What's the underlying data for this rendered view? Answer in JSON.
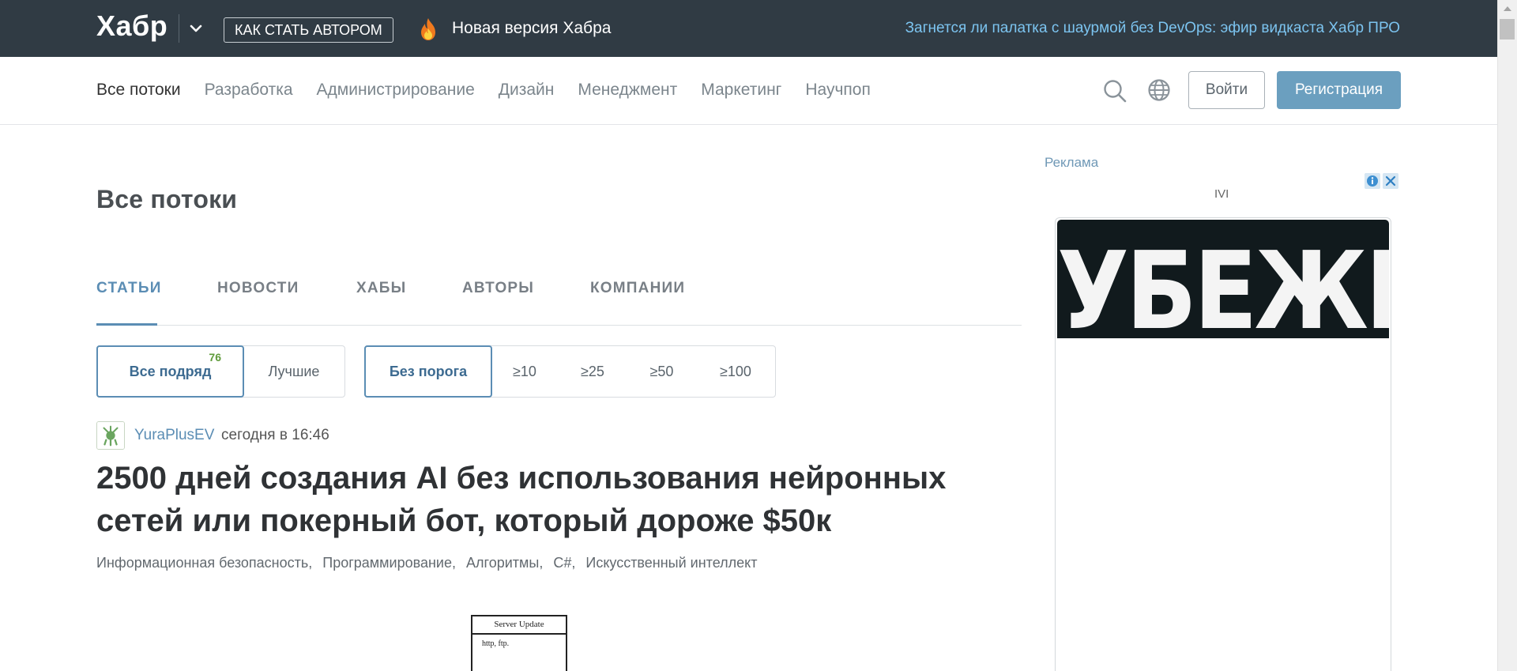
{
  "topbar": {
    "logo": "Хабр",
    "how_author": "Как стать автором",
    "new_version": "Новая версия Хабра",
    "promo": "Загнется ли палатка с шаурмой без DevOps: эфир видкаста Хабр ПРО",
    "fire_icon": "fire-icon"
  },
  "nav": {
    "items": [
      {
        "label": "Все потоки"
      },
      {
        "label": "Разработка"
      },
      {
        "label": "Администрирование"
      },
      {
        "label": "Дизайн"
      },
      {
        "label": "Менеджмент"
      },
      {
        "label": "Маркетинг"
      },
      {
        "label": "Научпоп"
      }
    ],
    "login": "Войти",
    "register": "Регистрация"
  },
  "main": {
    "title": "Все потоки",
    "tabs": [
      {
        "label": "СТАТЬИ"
      },
      {
        "label": "НОВОСТИ"
      },
      {
        "label": "ХАБЫ"
      },
      {
        "label": "АВТОРЫ"
      },
      {
        "label": "КОМПАНИИ"
      }
    ],
    "sort": {
      "all": "Все подряд",
      "all_count": "76",
      "best": "Лучшие"
    },
    "threshold": {
      "none": "Без порога",
      "t10": "≥10",
      "t25": "≥25",
      "t50": "≥50",
      "t100": "≥100"
    },
    "post": {
      "author": "YuraPlusEV",
      "time": "сегодня в 16:46",
      "title": "2500 дней создания AI без использования нейронных сетей или покерный бот, который дороже $50к",
      "hubs": [
        "Информационная безопасность,",
        "Программирование,",
        "Алгоритмы,",
        "C#,",
        "Искусственный интеллект"
      ],
      "diagram_title": "Server Update",
      "diagram_text": "http, ftp."
    }
  },
  "sidebar": {
    "ad_label": "Реклама",
    "ad_brand": "IVI",
    "banner_text": "УБЕЖИЩЕ"
  },
  "colors": {
    "topbar_bg": "#303b44",
    "accent": "#5b8db4",
    "register_bg": "#6b9fbf",
    "promo_link": "#7cc4f0",
    "count_green": "#5f9b3b"
  }
}
